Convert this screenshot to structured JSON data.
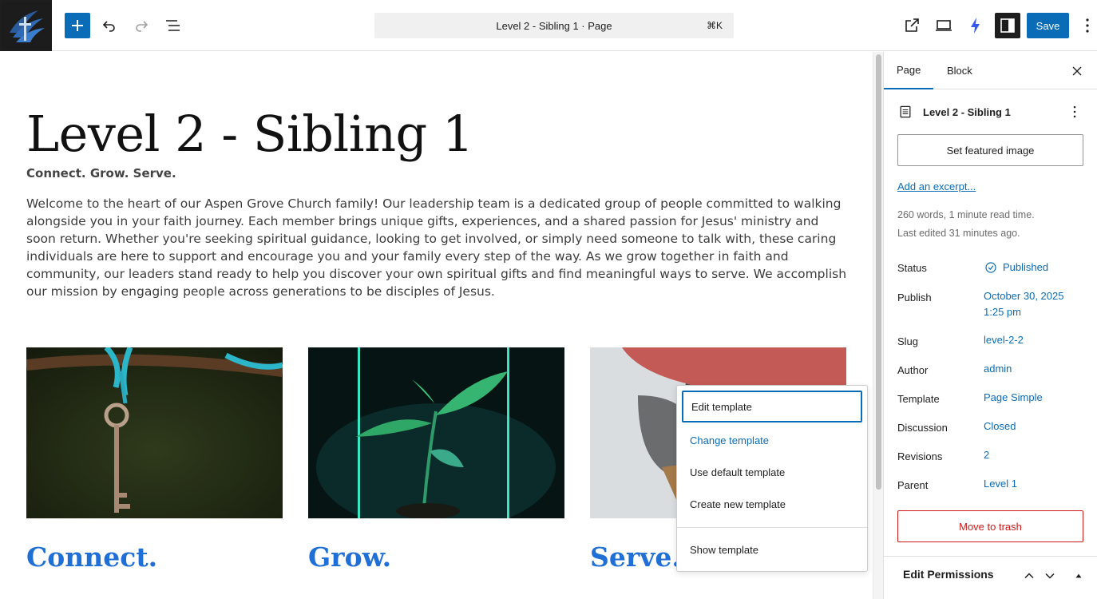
{
  "toolbar": {
    "document_title": "Level 2 - Sibling 1 · Page",
    "shortcut": "⌘K",
    "save_label": "Save"
  },
  "content": {
    "title": "Level 2 - Sibling 1",
    "tagline": "Connect. Grow. Serve.",
    "intro": "Welcome to the heart of our Aspen Grove Church family! Our leadership team is a dedicated group of people committed to walking alongside you in your faith journey. Each member brings unique gifts, experiences, and a shared passion for Jesus' ministry and soon return. Whether you're seeking spiritual guidance, looking to get involved, or simply need someone to talk with, these caring individuals are here to support and encourage you and your family every step of the way. As we grow together in faith and community, our leaders stand ready to help you discover your own spiritual gifts and find meaningful ways to serve. We accomplish our mission by engaging people across generations to be disciples of Jesus.",
    "cards": [
      {
        "title": "Connect."
      },
      {
        "title": "Grow."
      },
      {
        "title": "Serve."
      }
    ]
  },
  "template_menu": {
    "items": [
      "Edit template",
      "Change template",
      "Use default template",
      "Create new template",
      "Show template"
    ]
  },
  "sidebar": {
    "tabs": [
      "Page",
      "Block"
    ],
    "document_title": "Level 2 - Sibling 1",
    "featured_image_label": "Set featured image",
    "excerpt_link": "Add an excerpt...",
    "word_count": "260 words, 1 minute read time.",
    "last_edited": "Last edited 31 minutes ago.",
    "rows": {
      "status": {
        "label": "Status",
        "value": "Published"
      },
      "publish": {
        "label": "Publish",
        "value_line1": "October 30, 2025",
        "value_line2": "1:25 pm"
      },
      "slug": {
        "label": "Slug",
        "value": "level-2-2"
      },
      "author": {
        "label": "Author",
        "value": "admin"
      },
      "template": {
        "label": "Template",
        "value": "Page Simple"
      },
      "discussion": {
        "label": "Discussion",
        "value": "Closed"
      },
      "revisions": {
        "label": "Revisions",
        "value": "2"
      },
      "parent": {
        "label": "Parent",
        "value": "Level 1"
      }
    },
    "trash_label": "Move to trash",
    "permissions_title": "Edit Permissions"
  },
  "colors": {
    "accent": "#0a6cb7",
    "danger": "#cc1818",
    "heading_blue": "#1f6fd6"
  }
}
